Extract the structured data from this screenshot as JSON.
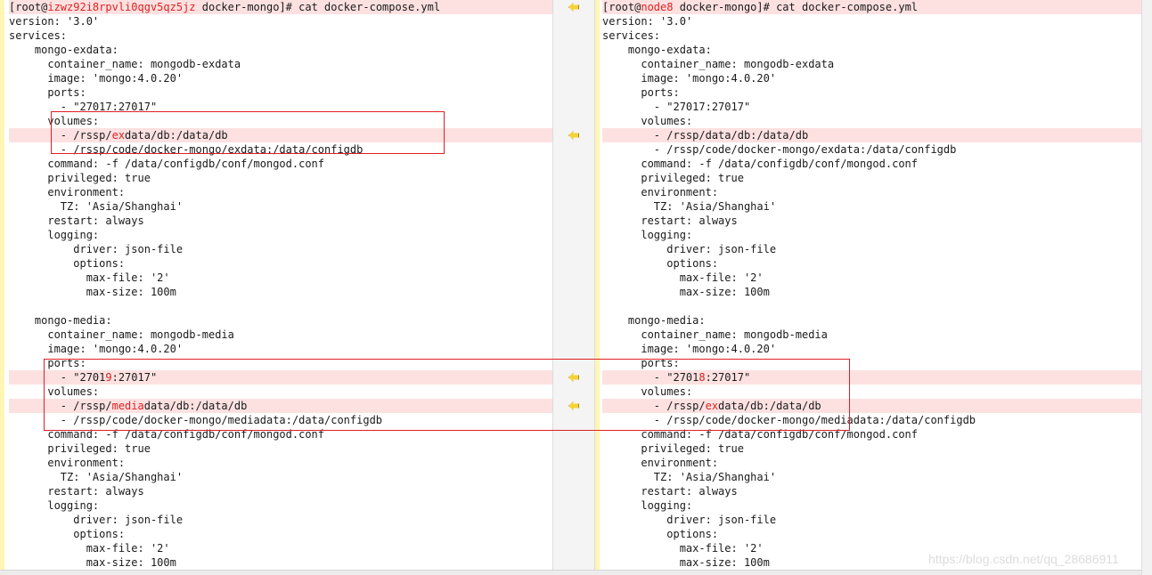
{
  "left": {
    "lines": [
      {
        "segs": [
          {
            "t": "[root@",
            "c": ""
          },
          {
            "t": "izwz92i8rpvli0qgv5qz5jz",
            "c": "hl"
          },
          {
            "t": " docker-mongo]# cat docker-compose.yml",
            "c": ""
          }
        ],
        "diff": true
      },
      {
        "segs": [
          {
            "t": "version: '3.0'",
            "c": ""
          }
        ]
      },
      {
        "segs": [
          {
            "t": "services:",
            "c": ""
          }
        ]
      },
      {
        "segs": [
          {
            "t": "    mongo-exdata:",
            "c": ""
          }
        ]
      },
      {
        "segs": [
          {
            "t": "      container_name: mongodb-exdata",
            "c": ""
          }
        ]
      },
      {
        "segs": [
          {
            "t": "      image: 'mongo:4.0.20'",
            "c": ""
          }
        ]
      },
      {
        "segs": [
          {
            "t": "      ports:",
            "c": ""
          }
        ]
      },
      {
        "segs": [
          {
            "t": "        - \"27017:27017\"",
            "c": ""
          }
        ]
      },
      {
        "segs": [
          {
            "t": "      volumes:",
            "c": ""
          }
        ]
      },
      {
        "segs": [
          {
            "t": "        - /rssp/",
            "c": ""
          },
          {
            "t": "ex",
            "c": "hl"
          },
          {
            "t": "data/db:/data/db",
            "c": ""
          }
        ],
        "diff": true
      },
      {
        "segs": [
          {
            "t": "        - /rssp/code/docker-mongo/exdata:/data/configdb",
            "c": ""
          }
        ]
      },
      {
        "segs": [
          {
            "t": "      command: -f /data/configdb/conf/mongod.conf",
            "c": ""
          }
        ]
      },
      {
        "segs": [
          {
            "t": "      privileged: true",
            "c": ""
          }
        ]
      },
      {
        "segs": [
          {
            "t": "      environment:",
            "c": ""
          }
        ]
      },
      {
        "segs": [
          {
            "t": "        TZ: 'Asia/Shanghai'",
            "c": ""
          }
        ]
      },
      {
        "segs": [
          {
            "t": "      restart: always",
            "c": ""
          }
        ]
      },
      {
        "segs": [
          {
            "t": "      logging:",
            "c": ""
          }
        ]
      },
      {
        "segs": [
          {
            "t": "          driver: json-file",
            "c": ""
          }
        ]
      },
      {
        "segs": [
          {
            "t": "          options:",
            "c": ""
          }
        ]
      },
      {
        "segs": [
          {
            "t": "            max-file: '2'",
            "c": ""
          }
        ]
      },
      {
        "segs": [
          {
            "t": "            max-size: 100m",
            "c": ""
          }
        ]
      },
      {
        "segs": [
          {
            "t": "",
            "c": ""
          }
        ]
      },
      {
        "segs": [
          {
            "t": "    mongo-media:",
            "c": ""
          }
        ]
      },
      {
        "segs": [
          {
            "t": "      container_name: mongodb-media",
            "c": ""
          }
        ]
      },
      {
        "segs": [
          {
            "t": "      image: 'mongo:4.0.20'",
            "c": ""
          }
        ]
      },
      {
        "segs": [
          {
            "t": "      ports:",
            "c": ""
          }
        ]
      },
      {
        "segs": [
          {
            "t": "        - \"2701",
            "c": ""
          },
          {
            "t": "9",
            "c": "hl"
          },
          {
            "t": ":27017\"",
            "c": ""
          }
        ],
        "diff": true
      },
      {
        "segs": [
          {
            "t": "      volumes:",
            "c": ""
          }
        ]
      },
      {
        "segs": [
          {
            "t": "        - /rssp/",
            "c": ""
          },
          {
            "t": "media",
            "c": "hl"
          },
          {
            "t": "data/db:/data/db",
            "c": ""
          }
        ],
        "diff": true
      },
      {
        "segs": [
          {
            "t": "        - /rssp/code/docker-mongo/mediadata:/data/configdb",
            "c": ""
          }
        ]
      },
      {
        "segs": [
          {
            "t": "      command: -f /data/configdb/conf/mongod.conf",
            "c": ""
          }
        ]
      },
      {
        "segs": [
          {
            "t": "      privileged: true",
            "c": ""
          }
        ]
      },
      {
        "segs": [
          {
            "t": "      environment:",
            "c": ""
          }
        ]
      },
      {
        "segs": [
          {
            "t": "        TZ: 'Asia/Shanghai'",
            "c": ""
          }
        ]
      },
      {
        "segs": [
          {
            "t": "      restart: always",
            "c": ""
          }
        ]
      },
      {
        "segs": [
          {
            "t": "      logging:",
            "c": ""
          }
        ]
      },
      {
        "segs": [
          {
            "t": "          driver: json-file",
            "c": ""
          }
        ]
      },
      {
        "segs": [
          {
            "t": "          options:",
            "c": ""
          }
        ]
      },
      {
        "segs": [
          {
            "t": "            max-file: '2'",
            "c": ""
          }
        ]
      },
      {
        "segs": [
          {
            "t": "            max-size: 100m",
            "c": ""
          }
        ]
      }
    ]
  },
  "right": {
    "lines": [
      {
        "segs": [
          {
            "t": "[root@",
            "c": ""
          },
          {
            "t": "node8",
            "c": "hl"
          },
          {
            "t": " docker-mongo]# cat docker-compose.yml",
            "c": ""
          }
        ],
        "diff": true
      },
      {
        "segs": [
          {
            "t": "version: '3.0'",
            "c": ""
          }
        ]
      },
      {
        "segs": [
          {
            "t": "services:",
            "c": ""
          }
        ]
      },
      {
        "segs": [
          {
            "t": "    mongo-exdata:",
            "c": ""
          }
        ]
      },
      {
        "segs": [
          {
            "t": "      container_name: mongodb-exdata",
            "c": ""
          }
        ]
      },
      {
        "segs": [
          {
            "t": "      image: 'mongo:4.0.20'",
            "c": ""
          }
        ]
      },
      {
        "segs": [
          {
            "t": "      ports:",
            "c": ""
          }
        ]
      },
      {
        "segs": [
          {
            "t": "        - \"27017:27017\"",
            "c": ""
          }
        ]
      },
      {
        "segs": [
          {
            "t": "      volumes:",
            "c": ""
          }
        ]
      },
      {
        "segs": [
          {
            "t": "        - /rssp/data/db:/data/db",
            "c": ""
          }
        ],
        "diff": true
      },
      {
        "segs": [
          {
            "t": "        - /rssp/code/docker-mongo/exdata:/data/configdb",
            "c": ""
          }
        ]
      },
      {
        "segs": [
          {
            "t": "      command: -f /data/configdb/conf/mongod.conf",
            "c": ""
          }
        ]
      },
      {
        "segs": [
          {
            "t": "      privileged: true",
            "c": ""
          }
        ]
      },
      {
        "segs": [
          {
            "t": "      environment:",
            "c": ""
          }
        ]
      },
      {
        "segs": [
          {
            "t": "        TZ: 'Asia/Shanghai'",
            "c": ""
          }
        ]
      },
      {
        "segs": [
          {
            "t": "      restart: always",
            "c": ""
          }
        ]
      },
      {
        "segs": [
          {
            "t": "      logging:",
            "c": ""
          }
        ]
      },
      {
        "segs": [
          {
            "t": "          driver: json-file",
            "c": ""
          }
        ]
      },
      {
        "segs": [
          {
            "t": "          options:",
            "c": ""
          }
        ]
      },
      {
        "segs": [
          {
            "t": "            max-file: '2'",
            "c": ""
          }
        ]
      },
      {
        "segs": [
          {
            "t": "            max-size: 100m",
            "c": ""
          }
        ]
      },
      {
        "segs": [
          {
            "t": "",
            "c": ""
          }
        ]
      },
      {
        "segs": [
          {
            "t": "    mongo-media:",
            "c": ""
          }
        ]
      },
      {
        "segs": [
          {
            "t": "      container_name: mongodb-media",
            "c": ""
          }
        ]
      },
      {
        "segs": [
          {
            "t": "      image: 'mongo:4.0.20'",
            "c": ""
          }
        ]
      },
      {
        "segs": [
          {
            "t": "      ports:",
            "c": ""
          }
        ]
      },
      {
        "segs": [
          {
            "t": "        - \"2701",
            "c": ""
          },
          {
            "t": "8",
            "c": "hl"
          },
          {
            "t": ":27017\"",
            "c": ""
          }
        ],
        "diff": true
      },
      {
        "segs": [
          {
            "t": "      volumes:",
            "c": ""
          }
        ]
      },
      {
        "segs": [
          {
            "t": "        - /rssp/",
            "c": ""
          },
          {
            "t": "ex",
            "c": "hl"
          },
          {
            "t": "data/db:/data/db",
            "c": ""
          }
        ],
        "diff": true
      },
      {
        "segs": [
          {
            "t": "        - /rssp/code/docker-mongo/mediadata:/data/configdb",
            "c": ""
          }
        ]
      },
      {
        "segs": [
          {
            "t": "      command: -f /data/configdb/conf/mongod.conf",
            "c": ""
          }
        ]
      },
      {
        "segs": [
          {
            "t": "      privileged: true",
            "c": ""
          }
        ]
      },
      {
        "segs": [
          {
            "t": "      environment:",
            "c": ""
          }
        ]
      },
      {
        "segs": [
          {
            "t": "        TZ: 'Asia/Shanghai'",
            "c": ""
          }
        ]
      },
      {
        "segs": [
          {
            "t": "      restart: always",
            "c": ""
          }
        ]
      },
      {
        "segs": [
          {
            "t": "      logging:",
            "c": ""
          }
        ]
      },
      {
        "segs": [
          {
            "t": "          driver: json-file",
            "c": ""
          }
        ]
      },
      {
        "segs": [
          {
            "t": "          options:",
            "c": ""
          }
        ]
      },
      {
        "segs": [
          {
            "t": "            max-file: '2'",
            "c": ""
          }
        ]
      },
      {
        "segs": [
          {
            "t": "            max-size: 100m",
            "c": ""
          }
        ]
      }
    ]
  },
  "arrow_lines": [
    0,
    9,
    26,
    28
  ],
  "arrow_icon": "copy-left-arrow-icon",
  "watermark": "https://blog.csdn.net/qq_28686911",
  "colors": {
    "diff_bg": "#fde1e1",
    "changed_text": "#e02020",
    "annotation": "#e01e25",
    "arrow": "#f5d23a",
    "gutter": "#fff6b3"
  }
}
